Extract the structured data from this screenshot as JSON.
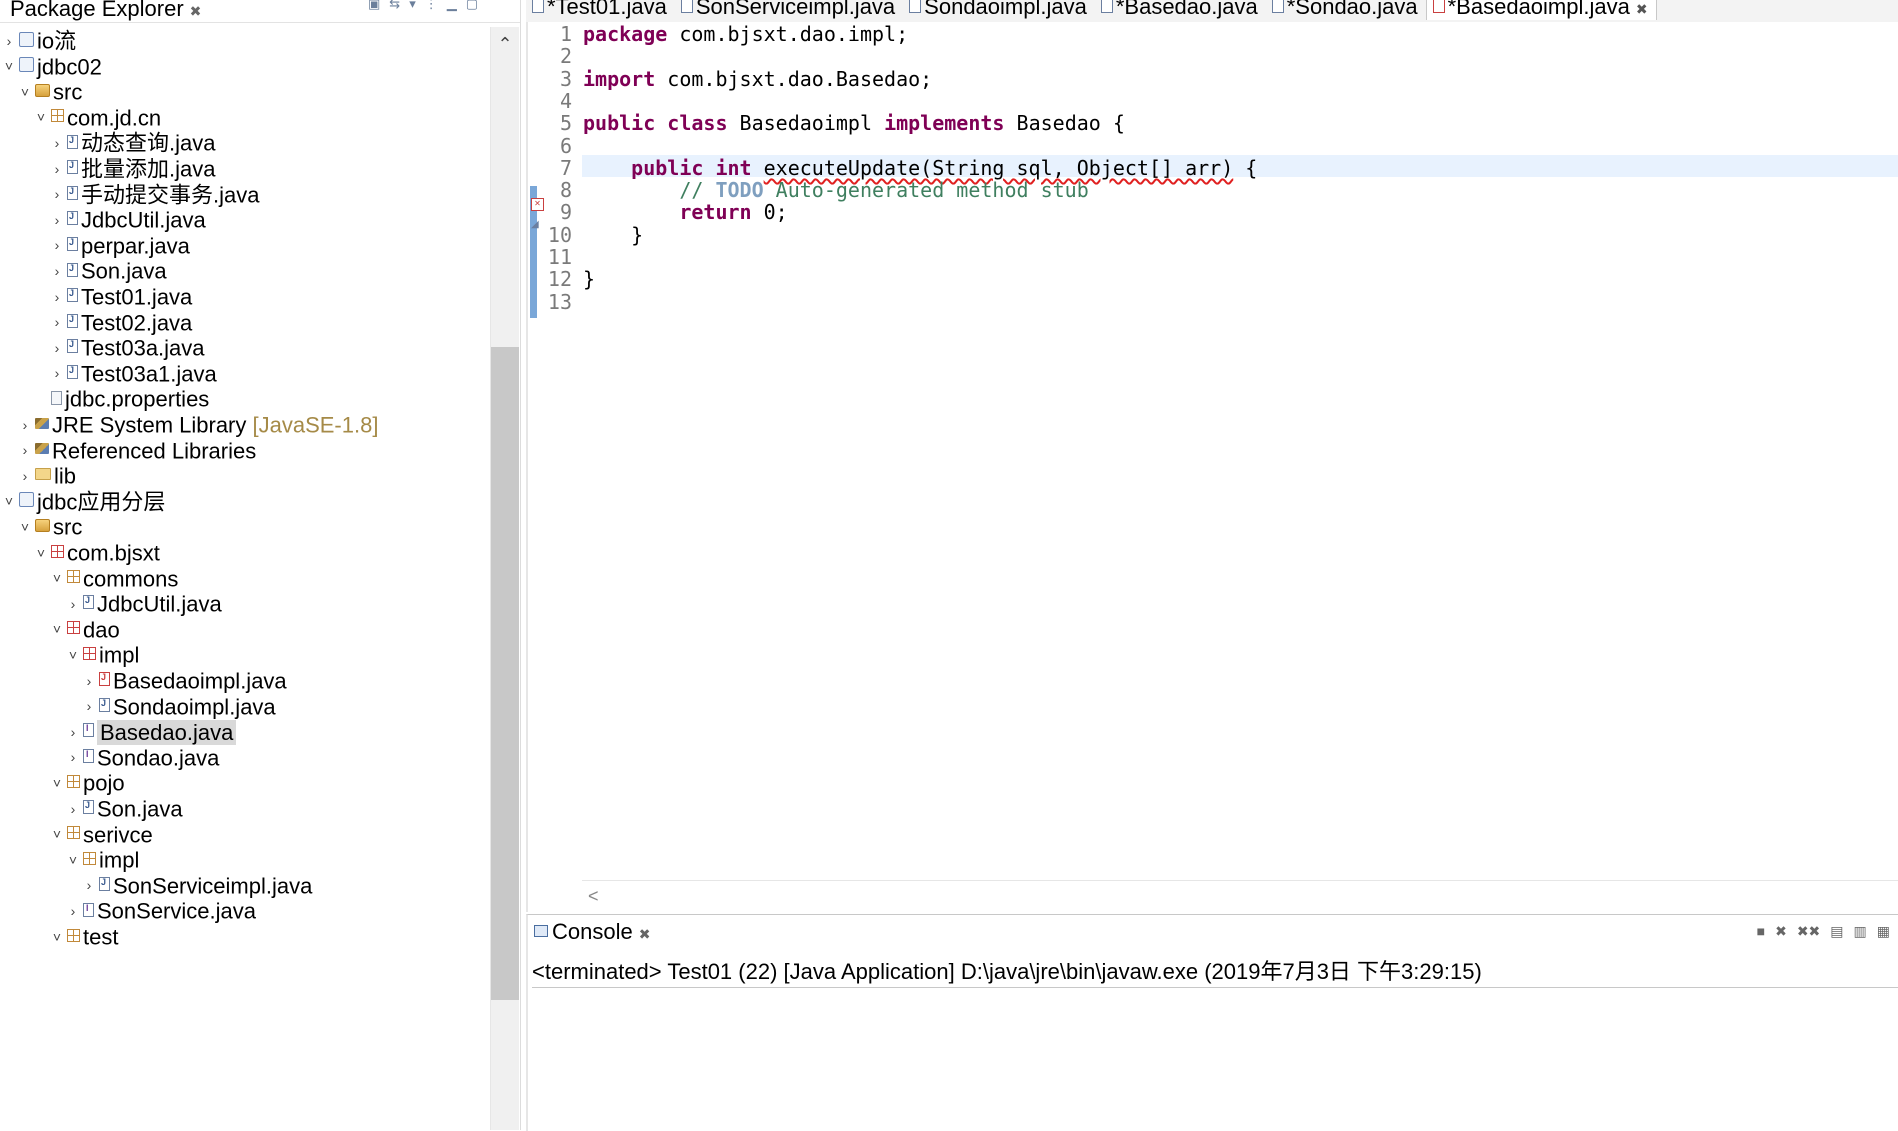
{
  "explorer": {
    "title": "Package Explorer",
    "close_glyph": "✖",
    "toolbar_icons": [
      "collapse-all-icon",
      "link-with-editor-icon",
      "filters-icon",
      "view-menu-icon",
      "minimize-icon",
      "maximize-icon"
    ],
    "items": [
      {
        "label": "io流",
        "decor": "",
        "level": 0,
        "arrow": "›",
        "icon": "project"
      },
      {
        "label": "jdbc02",
        "decor": "",
        "level": 0,
        "arrow": "˅",
        "icon": "project"
      },
      {
        "label": "src",
        "decor": "",
        "level": 1,
        "arrow": "˅",
        "icon": "src"
      },
      {
        "label": "com.jd.cn",
        "decor": "",
        "level": 2,
        "arrow": "˅",
        "icon": "pkg"
      },
      {
        "label": "动态查询.java",
        "decor": "",
        "level": 3,
        "arrow": "›",
        "icon": "java"
      },
      {
        "label": "批量添加.java",
        "decor": "",
        "level": 3,
        "arrow": "›",
        "icon": "java"
      },
      {
        "label": "手动提交事务.java",
        "decor": "",
        "level": 3,
        "arrow": "›",
        "icon": "java"
      },
      {
        "label": "JdbcUtil.java",
        "decor": "",
        "level": 3,
        "arrow": "›",
        "icon": "java"
      },
      {
        "label": "perpar.java",
        "decor": "",
        "level": 3,
        "arrow": "›",
        "icon": "java"
      },
      {
        "label": "Son.java",
        "decor": "",
        "level": 3,
        "arrow": "›",
        "icon": "java"
      },
      {
        "label": "Test01.java",
        "decor": "",
        "level": 3,
        "arrow": "›",
        "icon": "java"
      },
      {
        "label": "Test02.java",
        "decor": "",
        "level": 3,
        "arrow": "›",
        "icon": "java"
      },
      {
        "label": "Test03a.java",
        "decor": "",
        "level": 3,
        "arrow": "›",
        "icon": "java"
      },
      {
        "label": "Test03a1.java",
        "decor": "",
        "level": 3,
        "arrow": "›",
        "icon": "java"
      },
      {
        "label": "jdbc.properties",
        "decor": "",
        "level": 2,
        "arrow": "",
        "icon": "file"
      },
      {
        "label": "JRE System Library",
        "decor": " [JavaSE-1.8]",
        "level": 1,
        "arrow": "›",
        "icon": "lib"
      },
      {
        "label": "Referenced Libraries",
        "decor": "",
        "level": 1,
        "arrow": "›",
        "icon": "lib"
      },
      {
        "label": "lib",
        "decor": "",
        "level": 1,
        "arrow": "›",
        "icon": "folder"
      },
      {
        "label": "jdbc应用分层",
        "decor": "",
        "level": 0,
        "arrow": "˅",
        "icon": "project"
      },
      {
        "label": "src",
        "decor": "",
        "level": 1,
        "arrow": "˅",
        "icon": "src"
      },
      {
        "label": "com.bjsxt",
        "decor": "",
        "level": 2,
        "arrow": "˅",
        "icon": "pkg-err"
      },
      {
        "label": "commons",
        "decor": "",
        "level": 3,
        "arrow": "˅",
        "icon": "pkg"
      },
      {
        "label": "JdbcUtil.java",
        "decor": "",
        "level": 4,
        "arrow": "›",
        "icon": "java"
      },
      {
        "label": "dao",
        "decor": "",
        "level": 3,
        "arrow": "˅",
        "icon": "pkg-err"
      },
      {
        "label": "impl",
        "decor": "",
        "level": 4,
        "arrow": "˅",
        "icon": "pkg-err"
      },
      {
        "label": "Basedaoimpl.java",
        "decor": "",
        "level": 5,
        "arrow": "›",
        "icon": "java-err"
      },
      {
        "label": "Sondaoimpl.java",
        "decor": "",
        "level": 5,
        "arrow": "›",
        "icon": "java"
      },
      {
        "label": "Basedao.java",
        "decor": "",
        "level": 4,
        "arrow": "›",
        "icon": "iface",
        "selected": true
      },
      {
        "label": "Sondao.java",
        "decor": "",
        "level": 4,
        "arrow": "›",
        "icon": "iface"
      },
      {
        "label": "pojo",
        "decor": "",
        "level": 3,
        "arrow": "˅",
        "icon": "pkg"
      },
      {
        "label": "Son.java",
        "decor": "",
        "level": 4,
        "arrow": "›",
        "icon": "java"
      },
      {
        "label": "serivce",
        "decor": "",
        "level": 3,
        "arrow": "˅",
        "icon": "pkg"
      },
      {
        "label": "impl",
        "decor": "",
        "level": 4,
        "arrow": "˅",
        "icon": "pkg"
      },
      {
        "label": "SonServiceimpl.java",
        "decor": "",
        "level": 5,
        "arrow": "›",
        "icon": "java"
      },
      {
        "label": "SonService.java",
        "decor": "",
        "level": 4,
        "arrow": "›",
        "icon": "iface"
      },
      {
        "label": "test",
        "decor": "",
        "level": 3,
        "arrow": "˅",
        "icon": "pkg"
      }
    ]
  },
  "editor": {
    "tabs": [
      {
        "label": "*Test01.java",
        "error": false,
        "active": false
      },
      {
        "label": "SonServiceimpl.java",
        "error": false,
        "active": false
      },
      {
        "label": "Sondaoimpl.java",
        "error": false,
        "active": false
      },
      {
        "label": "*Basedao.java",
        "error": false,
        "active": false
      },
      {
        "label": "*Sondao.java",
        "error": false,
        "active": false
      },
      {
        "label": "*Basedaoimpl.java",
        "error": true,
        "active": true,
        "close": "✖"
      }
    ],
    "lines": [
      {
        "n": "1",
        "segments": [
          {
            "t": "package",
            "c": "kw"
          },
          {
            "t": " com.bjsxt.dao.impl;",
            "c": ""
          }
        ]
      },
      {
        "n": "2",
        "segments": []
      },
      {
        "n": "3",
        "segments": [
          {
            "t": "import",
            "c": "kw"
          },
          {
            "t": " com.bjsxt.dao.Basedao;",
            "c": ""
          }
        ]
      },
      {
        "n": "4",
        "segments": []
      },
      {
        "n": "5",
        "segments": [
          {
            "t": "public",
            "c": "kw"
          },
          {
            "t": " ",
            "c": ""
          },
          {
            "t": "class",
            "c": "kw"
          },
          {
            "t": " Basedaoimpl ",
            "c": ""
          },
          {
            "t": "implements",
            "c": "kw"
          },
          {
            "t": " Basedao {",
            "c": ""
          }
        ]
      },
      {
        "n": "6",
        "segments": []
      },
      {
        "n": "7",
        "segments": [
          {
            "t": "    ",
            "c": ""
          },
          {
            "t": "public",
            "c": "kw"
          },
          {
            "t": " ",
            "c": ""
          },
          {
            "t": "int",
            "c": "kw"
          },
          {
            "t": " ",
            "c": ""
          },
          {
            "t": "executeUpdate(String sql, Object[] arr)",
            "c": "err-u"
          },
          {
            "t": " {",
            "c": ""
          }
        ]
      },
      {
        "n": "8",
        "segments": [
          {
            "t": "        ",
            "c": ""
          },
          {
            "t": "// ",
            "c": "cm"
          },
          {
            "t": "TODO",
            "c": "todo"
          },
          {
            "t": " Auto-generated method stub",
            "c": "cm"
          }
        ]
      },
      {
        "n": "9",
        "segments": [
          {
            "t": "        ",
            "c": ""
          },
          {
            "t": "return",
            "c": "kw"
          },
          {
            "t": " 0;",
            "c": ""
          }
        ]
      },
      {
        "n": "10",
        "segments": [
          {
            "t": "    }",
            "c": ""
          }
        ]
      },
      {
        "n": "11",
        "segments": []
      },
      {
        "n": "12",
        "segments": [
          {
            "t": "}",
            "c": ""
          }
        ]
      },
      {
        "n": "13",
        "segments": []
      }
    ],
    "hscroll_left_glyph": "<"
  },
  "console": {
    "tab_label": "Console",
    "close_glyph": "✖",
    "toolbar_icons": [
      "terminate-icon",
      "remove-launch-icon",
      "remove-all-terminated-icon",
      "clear-console-icon",
      "scroll-lock-icon",
      "pin-console-icon"
    ],
    "status": "<terminated> Test01 (22) [Java Application] D:\\java\\jre\\bin\\javaw.exe (2019年7月3日 下午3:29:15)"
  }
}
